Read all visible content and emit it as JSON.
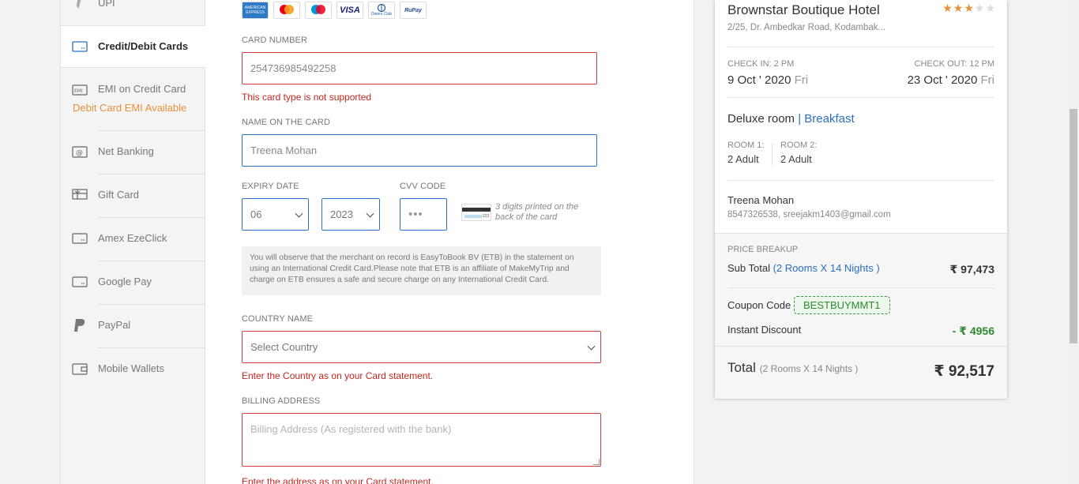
{
  "payment_modes": [
    {
      "key": "upi",
      "label": "UPI",
      "icon": "upi-icon"
    },
    {
      "key": "cards",
      "label": "Credit/Debit Cards",
      "icon": "credit-card-icon",
      "active": true
    },
    {
      "key": "emi",
      "label": "EMI on Credit Card",
      "sub": "Debit Card EMI Available",
      "icon": "emi-icon"
    },
    {
      "key": "netbanking",
      "label": "Net Banking",
      "icon": "net-banking-icon"
    },
    {
      "key": "giftcard",
      "label": "Gift Card",
      "icon": "gift-card-icon"
    },
    {
      "key": "amex",
      "label": "Amex EzeClick",
      "icon": "card-icon"
    },
    {
      "key": "gpay",
      "label": "Google Pay",
      "icon": "card-icon"
    },
    {
      "key": "paypal",
      "label": "PayPal",
      "icon": "paypal-icon"
    },
    {
      "key": "wallets",
      "label": "Mobile Wallets",
      "icon": "wallet-icon"
    }
  ],
  "card_logos": [
    "AMERICAN EXPRESS",
    "mastercard",
    "maestro",
    "VISA",
    "Diners Club",
    "RuPay"
  ],
  "form": {
    "card_number_label": "CARD NUMBER",
    "card_number_value": "254736985492258",
    "card_number_error": "This card type is not supported",
    "name_label": "NAME ON THE CARD",
    "name_value": "Treena Mohan",
    "expiry_label": "EXPIRY DATE",
    "expiry_month": "06",
    "expiry_year": "2023",
    "cvv_label": "CVV CODE",
    "cvv_value": "•••",
    "cvv_help": "3 digits printed on the back of the card",
    "note": "You will observe that the merchant on record is EasyToBook BV (ETB) in the statement on using an International Credit Card.Please note that ETB is an affiliate of MakeMyTrip and charge on ETB ensures a safe and secure charge on any International Credit Card.",
    "country_label": "COUNTRY NAME",
    "country_placeholder": "Select Country",
    "country_error": "Enter the Country as on your Card statement.",
    "address_label": "BILLING ADDRESS",
    "address_placeholder": "Billing Address (As registered with the bank)",
    "address_error": "Enter the address as on your Card statement."
  },
  "summary": {
    "hotel_name": "Brownstar Boutique Hotel",
    "stars_filled": 3,
    "stars_total": 5,
    "address": "2/25, Dr. Ambedkar Road, Kodambak...",
    "check_in_label": "CHECK IN: 2 PM",
    "check_in_date": "9 Oct ' 2020",
    "check_in_day": "Fri",
    "check_out_label": "CHECK OUT: 12 PM",
    "check_out_date": "23 Oct ' 2020",
    "check_out_day": "Fri",
    "room_type": "Deluxe room",
    "room_sep": "|",
    "meal_plan": "Breakfast",
    "rooms": [
      {
        "label": "ROOM 1:",
        "guests": "2 Adult"
      },
      {
        "label": "ROOM 2:",
        "guests": "2 Adult"
      }
    ],
    "guest_name": "Treena Mohan",
    "guest_contact": "8547326538, sreejakm1403@gmail.com",
    "price_breakup_label": "PRICE BREAKUP",
    "subtotal_label": "Sub Total",
    "subtotal_detail": "(2 Rooms X 14 Nights )",
    "subtotal_value": "₹ 97,473",
    "coupon_label": "Coupon Code",
    "coupon_code": "BESTBUYMMT1",
    "discount_label": "Instant Discount",
    "discount_value": "- ₹ 4956",
    "total_label": "Total",
    "total_detail": "(2 Rooms X 14 Nights )",
    "total_value": "₹ 92,517"
  },
  "colors": {
    "error": "#c7261e",
    "link": "#2a6ec4",
    "discount": "#2f8a2f",
    "star": "#e8903a",
    "emi_sub": "#e8903a"
  }
}
